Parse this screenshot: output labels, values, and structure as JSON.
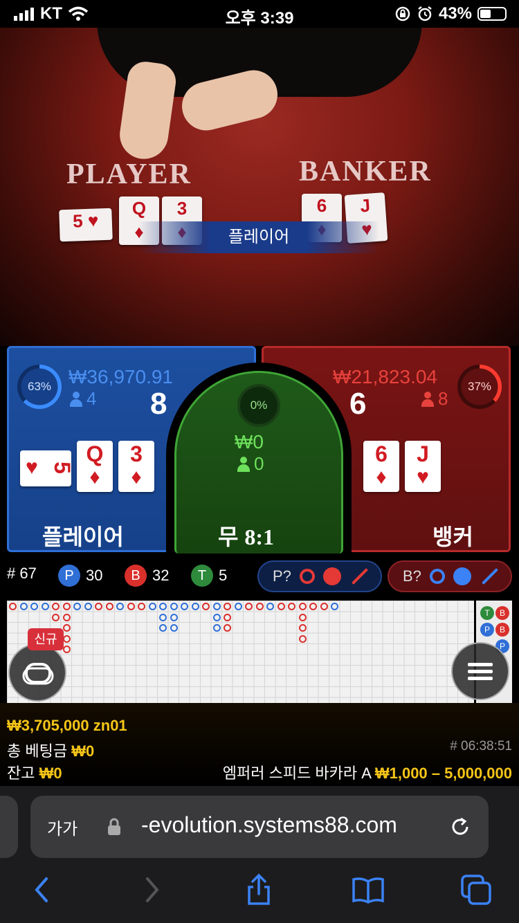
{
  "status_bar": {
    "carrier": "KT",
    "time": "오후 3:39",
    "battery": "43%",
    "battery_level": 0.43
  },
  "video": {
    "table_player_label": "PLAYER",
    "table_banker_label": "BANKER",
    "banner": "플레이어",
    "player_cards": [
      {
        "rank": "5",
        "suit": "♥"
      },
      {
        "rank": "Q",
        "suit": "♦"
      },
      {
        "rank": "3",
        "suit": "♦"
      }
    ],
    "banker_cards": [
      {
        "rank": "6",
        "suit": "♦"
      },
      {
        "rank": "J",
        "suit": "♥"
      }
    ]
  },
  "player": {
    "percent": "63%",
    "percent_value": 0.63,
    "amount": "₩36,970.91",
    "bettors": "4",
    "score": "8",
    "label": "플레이어",
    "cards": [
      {
        "rank": "5",
        "suit": "♥",
        "sideways": true
      },
      {
        "rank": "Q",
        "suit": "♦"
      },
      {
        "rank": "3",
        "suit": "♦"
      }
    ],
    "color": "#2f6fd6"
  },
  "tie": {
    "percent": "0%",
    "amount": "₩0",
    "bettors": "0",
    "label": "무",
    "payout": "8:1",
    "color": "#3fa636"
  },
  "banker": {
    "percent": "37%",
    "percent_value": 0.37,
    "amount": "₩21,823.04",
    "bettors": "8",
    "score": "6",
    "label": "뱅커",
    "cards": [
      {
        "rank": "6",
        "suit": "♦"
      },
      {
        "rank": "J",
        "suit": "♥"
      }
    ],
    "color": "#d9302c"
  },
  "stats": {
    "round": "# 67",
    "player_badge": "P",
    "player_count": "30",
    "banker_badge": "B",
    "banker_count": "32",
    "tie_badge": "T",
    "tie_count": "5",
    "player_predict": "P?",
    "banker_predict": "B?"
  },
  "roadmap": {
    "new_tag": "신규",
    "side_badges": [
      "T",
      "B",
      "P",
      "B",
      "P"
    ]
  },
  "info": {
    "balance_line": "₩3,705,000 zn01",
    "total_bet_label": "총 베팅금",
    "total_bet": "₩0",
    "balance_label": "잔고",
    "balance": "₩0",
    "game_id": "# 06:38:51",
    "table_name": "엠퍼러 스피드 바카라 A",
    "limits": "₩1,000 – 5,000,000"
  },
  "browser": {
    "aa": "가가",
    "url": "-evolution.systems88.com"
  }
}
